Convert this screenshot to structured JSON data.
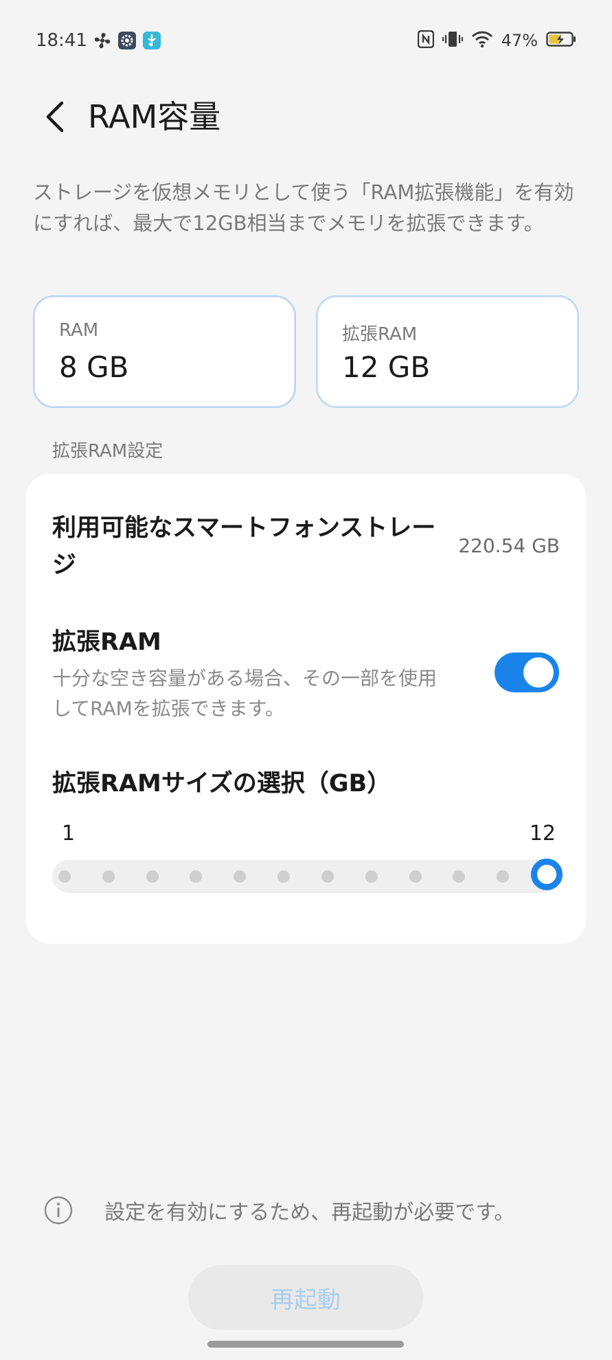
{
  "status_bar": {
    "time": "18:41",
    "battery": "47%",
    "icons_left": [
      "fan-icon",
      "gear-icon",
      "usb-icon"
    ],
    "icons_right": [
      "nfc-icon",
      "vibrate-icon",
      "wifi-icon",
      "battery-charging-icon"
    ]
  },
  "header": {
    "title": "RAM容量"
  },
  "description": "ストレージを仮想メモリとして使う「RAM拡張機能」を有効にすれば、最大で12GB相当までメモリを拡張できます。",
  "cards": {
    "ram_label": "RAM",
    "ram_value": "8 GB",
    "ext_label": "拡張RAM",
    "ext_value": "12 GB"
  },
  "section_label": "拡張RAM設定",
  "settings": {
    "storage_title": "利用可能なスマートフォンストレージ",
    "storage_value": "220.54 GB",
    "ext_title": "拡張RAM",
    "ext_subtitle": "十分な空き容量がある場合、その一部を使用してRAMを拡張できます。",
    "ext_enabled": true,
    "size_title": "拡張RAMサイズの選択（GB）",
    "slider_min": "1",
    "slider_max": "12",
    "slider_steps": 12,
    "slider_value": 12
  },
  "footer": {
    "info_text": "設定を有効にするため、再起動が必要です。",
    "restart_label": "再起動"
  },
  "colors": {
    "accent": "#1a84ea",
    "background": "#f4f4f4",
    "card": "#ffffff"
  }
}
